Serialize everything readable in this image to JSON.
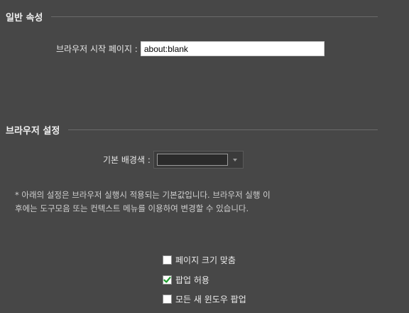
{
  "general": {
    "title": "일반 속성",
    "start_page_label": "브라우저 시작 페이지 :",
    "start_page_value": "about:blank"
  },
  "browser": {
    "title": "브라우저 설정",
    "bg_color_label": "기본 배경색 :",
    "bg_color_value": "#2b2b2b",
    "note_line1": "* 아래의 설정은 브라우저 실행시 적용되는 기본값입니다. 브라우저 실행 이",
    "note_line2": "후에는 도구모음 또는 컨텍스트 메뉴를 이용하여 변경할 수 있습니다."
  },
  "options": [
    {
      "label": "페이지 크기 맞춤",
      "checked": false
    },
    {
      "label": "팝업 허용",
      "checked": true
    },
    {
      "label": "모든 새 윈도우 팝업",
      "checked": false
    }
  ],
  "colors": {
    "background": "#474747",
    "checkmark": "#1f9d2e"
  }
}
